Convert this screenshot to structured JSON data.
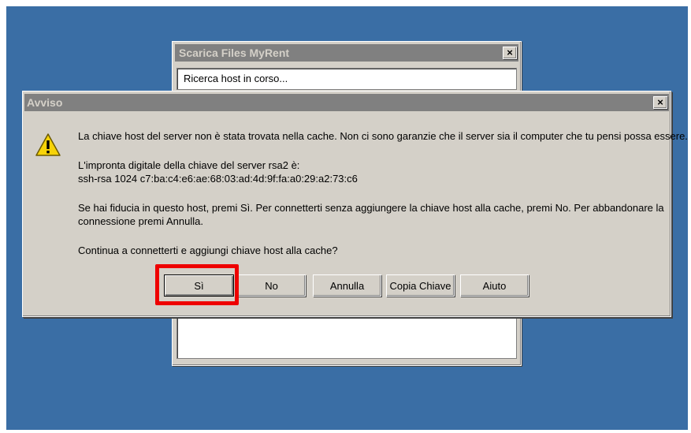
{
  "background_window": {
    "title": "Scarica Files MyRent",
    "status_text": "Ricerca host in corso...",
    "close_glyph": "×"
  },
  "dialog": {
    "title": "Avviso",
    "close_glyph": "×",
    "icon": "warning-icon",
    "line1": "La chiave host del server non è stata trovata nella cache. Non ci sono garanzie che il server sia il computer che tu pensi possa essere.",
    "line2": "L'impronta digitale della chiave del server rsa2 è:",
    "line3": "ssh-rsa 1024 c7:ba:c4:e6:ae:68:03:ad:4d:9f:fa:a0:29:a2:73:c6",
    "line4": "Se hai fiducia in questo host, premi Sì. Per connetterti senza aggiungere la chiave host alla cache, premi No. Per abbandonare la",
    "line5": "connessione premi Annulla.",
    "line6": "Continua a connetterti e aggiungi chiave host alla cache?",
    "buttons": {
      "yes": "Sì",
      "no": "No",
      "cancel": "Annulla",
      "copy_key": "Copia Chiave",
      "help": "Aiuto"
    }
  },
  "colors": {
    "desktop": "#3a6ea5",
    "face": "#d4d0c8",
    "inactive_title": "#808080",
    "highlight": "#ee0000"
  }
}
